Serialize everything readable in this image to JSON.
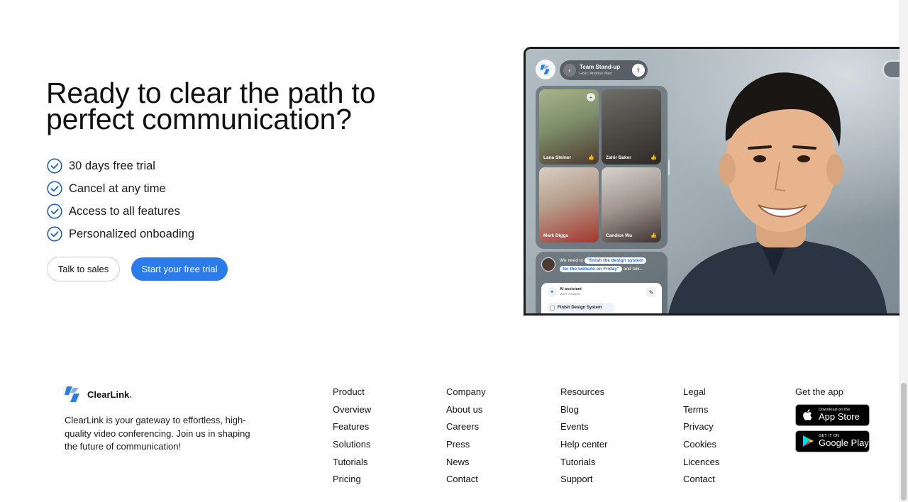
{
  "hero": {
    "title": "Ready to clear the path to perfect communication?",
    "features": [
      "30 days free trial",
      "Cancel at any time",
      "Access to all features",
      "Personalized onboading"
    ],
    "btn_sales": "Talk to sales",
    "btn_trial": "Start your free trial",
    "accent_color": "#2b7ce8"
  },
  "meeting": {
    "title": "Team Stand-up",
    "host": "Host: Andrew Wed",
    "participants": [
      "Lana Steiner",
      "Zahir Baker",
      "Mark Diggs",
      "Candice Wu"
    ],
    "chat_prefix": "We need to",
    "chat_highlight_1": "\"finish the design system",
    "chat_highlight_2": "for the website on Friday\"",
    "chat_suffix": "and talk...",
    "ai_title": "AI assistant",
    "ai_sub": "Voice Analyzer",
    "task": "Finish Design System"
  },
  "footer": {
    "brand_name": "ClearLink",
    "brand_dot": ".",
    "description": "ClearLink is your gateway to effortless, high-quality video conferencing. Join us in shaping the future of communication!",
    "columns": {
      "product": {
        "head": "Product",
        "links": [
          "Overview",
          "Features",
          "Solutions",
          "Tutorials",
          "Pricing"
        ]
      },
      "company": {
        "head": "Company",
        "links": [
          "About us",
          "Careers",
          "Press",
          "News",
          "Contact"
        ]
      },
      "resources": {
        "head": "Resources",
        "links": [
          "Blog",
          "Events",
          "Help center",
          "Tutorials",
          "Support"
        ]
      },
      "legal": {
        "head": "Legal",
        "links": [
          "Terms",
          "Privacy",
          "Cookies",
          "Licences",
          "Contact"
        ]
      }
    },
    "app": {
      "head": "Get the app",
      "appstore_small": "Download on the",
      "appstore_big": "App Store",
      "googleplay_small": "GET IT ON",
      "googleplay_big": "Google Play"
    }
  }
}
